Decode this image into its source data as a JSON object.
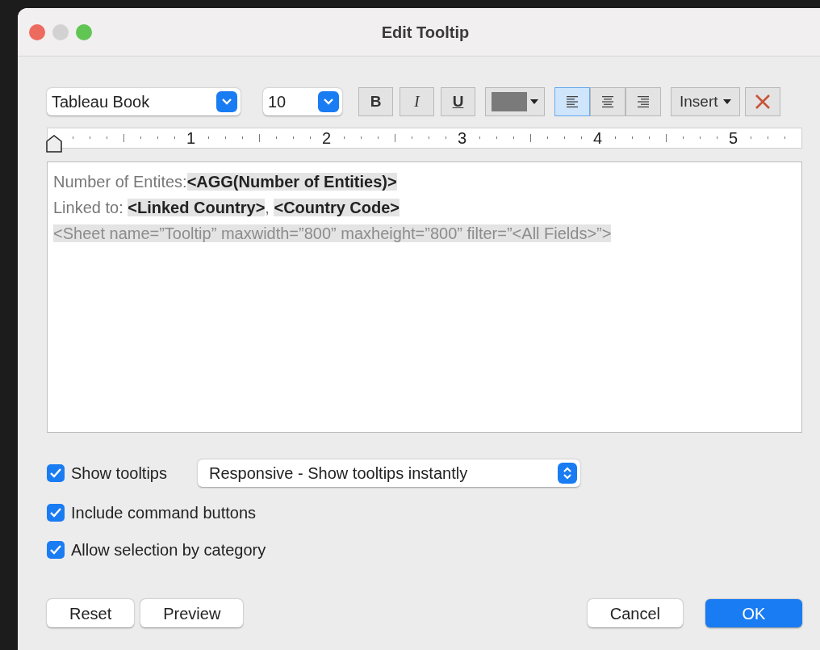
{
  "window": {
    "title": "Edit Tooltip"
  },
  "toolbar": {
    "font": "Tableau Book",
    "size": "10",
    "styles": [
      {
        "label": "B",
        "kind": "bold",
        "selected": false
      },
      {
        "label": "I",
        "kind": "italic",
        "selected": false
      },
      {
        "label": "U",
        "kind": "underline",
        "selected": false
      }
    ],
    "color": "#7a7a7a",
    "align": [
      {
        "kind": "left",
        "selected": true
      },
      {
        "kind": "center",
        "selected": false
      },
      {
        "kind": "right",
        "selected": false
      }
    ],
    "insert": "Insert"
  },
  "ruler": {
    "labels": [
      "1",
      "2",
      "3",
      "4",
      "5"
    ]
  },
  "editor": {
    "lines": [
      [
        {
          "kind": "plain",
          "text": "Number of Entites:"
        },
        {
          "kind": "field",
          "text": "<AGG(Number of Entities)>"
        }
      ],
      [
        {
          "kind": "plain",
          "text": "Linked to: "
        },
        {
          "kind": "field",
          "text": "<Linked Country>"
        },
        {
          "kind": "plain",
          "text": ", "
        },
        {
          "kind": "field",
          "text": "<Country Code>"
        }
      ],
      [
        {
          "kind": "sheet",
          "text": "<Sheet name=”Tooltip” maxwidth=”800” maxheight=”800” filter=”<All Fields>”>"
        }
      ]
    ]
  },
  "options": [
    {
      "label": "Show tooltips",
      "checked": true,
      "select": "Responsive - Show tooltips instantly"
    },
    {
      "label": "Include command buttons",
      "checked": true
    },
    {
      "label": "Allow selection by category",
      "checked": true
    }
  ],
  "buttons": {
    "left": [
      "Reset",
      "Preview"
    ],
    "cancel": "Cancel",
    "ok": "OK"
  }
}
